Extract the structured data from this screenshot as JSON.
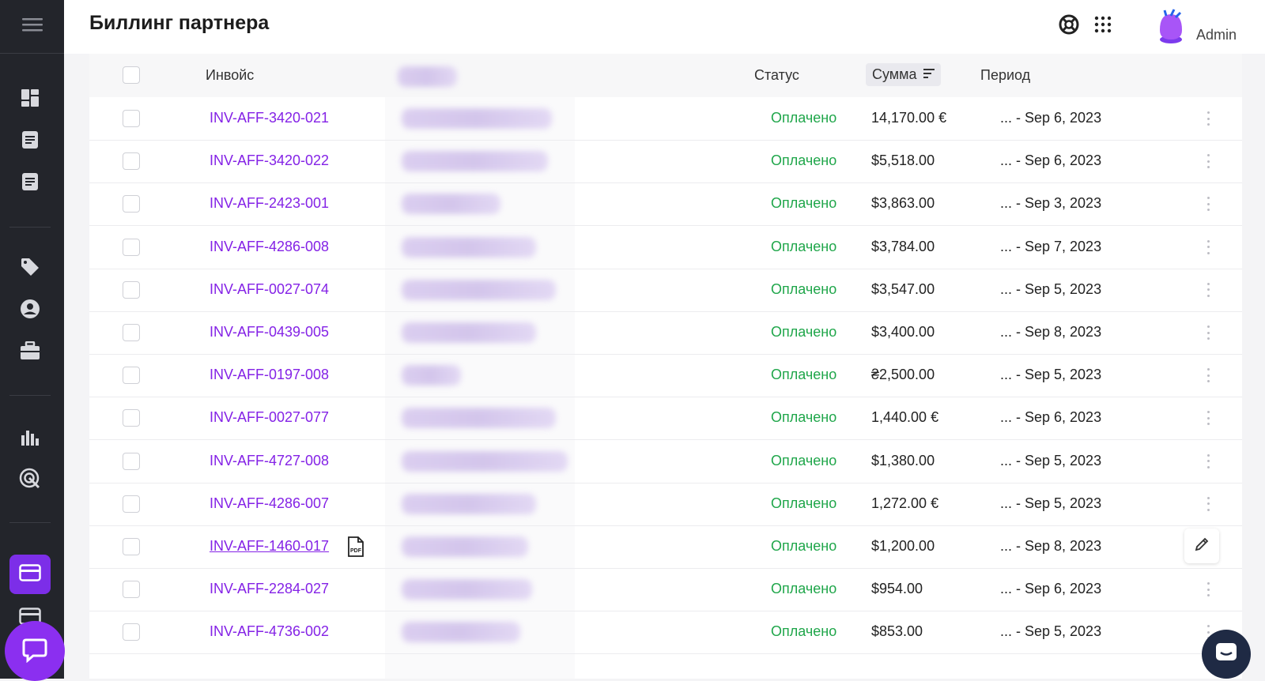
{
  "header": {
    "title": "Биллинг партнера",
    "user_label": "Admin"
  },
  "table": {
    "columns": {
      "invoice": "Инвойс",
      "status": "Статус",
      "amount": "Сумма",
      "period": "Период"
    },
    "rows": [
      {
        "invoice": "INV-AFF-3420-021",
        "status": "Оплачено",
        "amount": "14,170.00 €",
        "period": "... - Sep 6, 2023"
      },
      {
        "invoice": "INV-AFF-3420-022",
        "status": "Оплачено",
        "amount": "$5,518.00",
        "period": "... - Sep 6, 2023"
      },
      {
        "invoice": "INV-AFF-2423-001",
        "status": "Оплачено",
        "amount": "$3,863.00",
        "period": "... - Sep 3, 2023"
      },
      {
        "invoice": "INV-AFF-4286-008",
        "status": "Оплачено",
        "amount": "$3,784.00",
        "period": "... - Sep 7, 2023"
      },
      {
        "invoice": "INV-AFF-0027-074",
        "status": "Оплачено",
        "amount": "$3,547.00",
        "period": "... - Sep 5, 2023"
      },
      {
        "invoice": "INV-AFF-0439-005",
        "status": "Оплачено",
        "amount": "$3,400.00",
        "period": "... - Sep 8, 2023"
      },
      {
        "invoice": "INV-AFF-0197-008",
        "status": "Оплачено",
        "amount": "₴2,500.00",
        "period": "... - Sep 5, 2023"
      },
      {
        "invoice": "INV-AFF-0027-077",
        "status": "Оплачено",
        "amount": "1,440.00 €",
        "period": "... - Sep 6, 2023"
      },
      {
        "invoice": "INV-AFF-4727-008",
        "status": "Оплачено",
        "amount": "$1,380.00",
        "period": "... - Sep 5, 2023"
      },
      {
        "invoice": "INV-AFF-4286-007",
        "status": "Оплачено",
        "amount": "1,272.00 €",
        "period": "... - Sep 5, 2023"
      },
      {
        "invoice": "INV-AFF-1460-017",
        "status": "Оплачено",
        "amount": "$1,200.00",
        "period": "... - Sep 8, 2023"
      },
      {
        "invoice": "INV-AFF-2284-027",
        "status": "Оплачено",
        "amount": "$954.00",
        "period": "... - Sep 6, 2023"
      },
      {
        "invoice": "INV-AFF-4736-002",
        "status": "Оплачено",
        "amount": "$853.00",
        "period": "... - Sep 5, 2023"
      }
    ]
  },
  "colors": {
    "accent": "#8422e6",
    "status_paid": "#1fa64a",
    "sidebar_bg": "#23252b"
  },
  "icons": {
    "sidebar": [
      "menu-icon",
      "dashboard-icon",
      "document-icon",
      "document-icon",
      "tag-icon",
      "user-icon",
      "briefcase-icon",
      "bar-chart-icon",
      "target-icon",
      "card-icon",
      "card-icon",
      "chat-icon"
    ],
    "topbar": [
      "help-icon",
      "apps-grid-icon",
      "avatar"
    ]
  }
}
